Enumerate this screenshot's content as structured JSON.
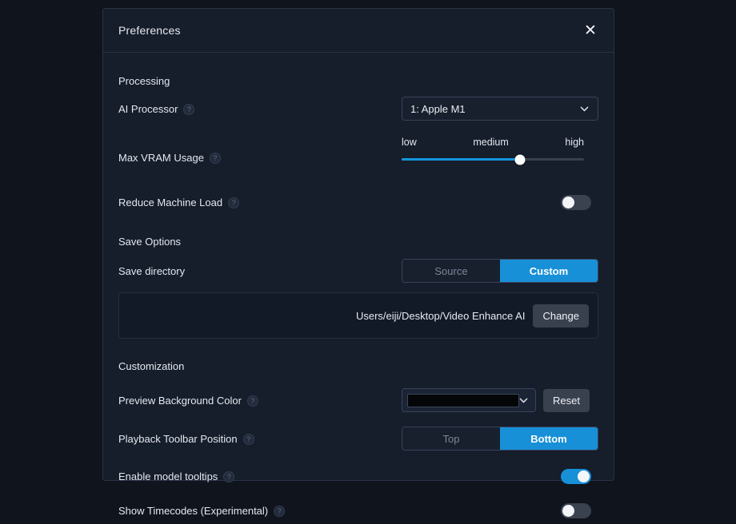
{
  "dialog": {
    "title": "Preferences",
    "close_label": "✕"
  },
  "sections": {
    "processing": {
      "title": "Processing",
      "ai_processor": {
        "label": "AI Processor",
        "help": "?",
        "value": "1: Apple M1",
        "chevron": "chevron-down"
      },
      "max_vram": {
        "label": "Max VRAM Usage",
        "help": "?",
        "ticks": [
          "low",
          "medium",
          "high"
        ],
        "value_percent": 65
      },
      "reduce_machine_load": {
        "label": "Reduce Machine Load",
        "help": "?",
        "state": "off"
      }
    },
    "save_options": {
      "title": "Save Options",
      "save_directory": {
        "label": "Save directory",
        "options": [
          "Source",
          "Custom"
        ],
        "selected": "Custom"
      },
      "path": {
        "value": "Users/eiji/Desktop/Video Enhance AI",
        "change_label": "Change"
      }
    },
    "customization": {
      "title": "Customization",
      "preview_background_color": {
        "label": "Preview Background Color",
        "help": "?",
        "swatch_color": "#050608",
        "reset_label": "Reset"
      },
      "playback_toolbar_position": {
        "label": "Playback Toolbar Position",
        "help": "?",
        "options": [
          "Top",
          "Bottom"
        ],
        "selected": "Bottom"
      },
      "enable_model_tooltips": {
        "label": "Enable model tooltips",
        "help": "?",
        "state": "on"
      },
      "show_timecodes": {
        "label": "Show Timecodes (Experimental)",
        "help": "?",
        "state": "off"
      }
    }
  },
  "theme": {
    "accent": "#1890d8",
    "slider_fill": "#1596dd",
    "dialog_bg": "#161d2b",
    "page_bg": "#10141c"
  }
}
